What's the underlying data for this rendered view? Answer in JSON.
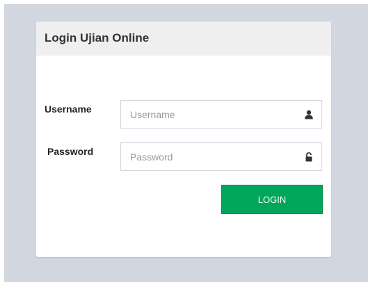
{
  "login_box": {
    "title": "Login Ujian Online",
    "username": {
      "label": "Username",
      "placeholder": "Username",
      "value": "",
      "icon": "user-icon"
    },
    "password": {
      "label": "Password",
      "placeholder": "Password",
      "value": "",
      "icon": "unlock-icon"
    },
    "login_label": "LOGIN"
  },
  "colors": {
    "background": "#d2d6de",
    "header": "#efefef",
    "button": "#00a65a"
  }
}
